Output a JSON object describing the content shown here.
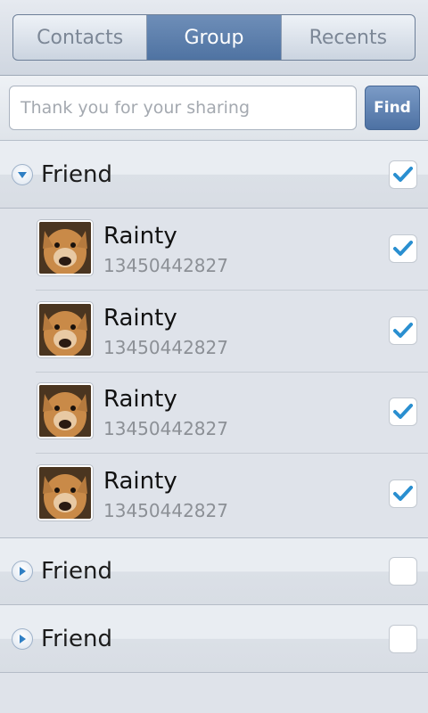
{
  "tabs": [
    {
      "label": "Contacts",
      "active": false
    },
    {
      "label": "Group",
      "active": true
    },
    {
      "label": "Recents",
      "active": false
    }
  ],
  "search": {
    "placeholder": "Thank you for your sharing",
    "value": "",
    "button_label": "Find"
  },
  "groups": [
    {
      "label": "Friend",
      "expanded": true,
      "checked": true,
      "contacts": [
        {
          "name": "Rainty",
          "phone": "13450442827",
          "checked": true
        },
        {
          "name": "Rainty",
          "phone": "13450442827",
          "checked": true
        },
        {
          "name": "Rainty",
          "phone": "13450442827",
          "checked": true
        },
        {
          "name": "Rainty",
          "phone": "13450442827",
          "checked": true
        }
      ]
    },
    {
      "label": "Friend",
      "expanded": false,
      "checked": false,
      "contacts": []
    },
    {
      "label": "Friend",
      "expanded": false,
      "checked": false,
      "contacts": []
    }
  ],
  "colors": {
    "accent": "#4f73a2",
    "check": "#2a8fd0",
    "background": "#dfe3ea"
  },
  "icons": {
    "expanded": "triangle-down-icon",
    "collapsed": "triangle-right-icon",
    "check": "checkmark-icon",
    "avatar": "dog-photo-avatar"
  }
}
